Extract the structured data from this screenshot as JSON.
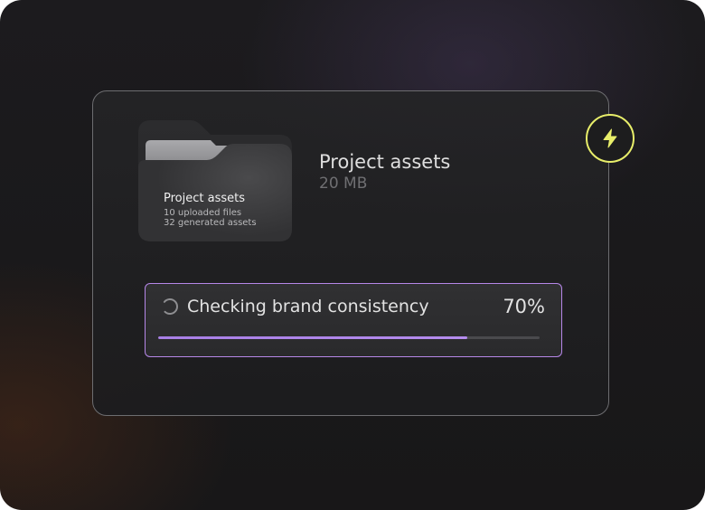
{
  "folder": {
    "title": "Project assets",
    "uploaded_files": "10 uploaded files",
    "generated_assets": "32 generated assets"
  },
  "info": {
    "title": "Project assets",
    "size": "20 MB"
  },
  "badge": {
    "icon": "lightning-bolt-icon",
    "color": "#e8ee6a"
  },
  "progress": {
    "label": "Checking brand consistency",
    "percent_text": "70%",
    "value": 0.81,
    "accent_color": "#b687e8"
  }
}
